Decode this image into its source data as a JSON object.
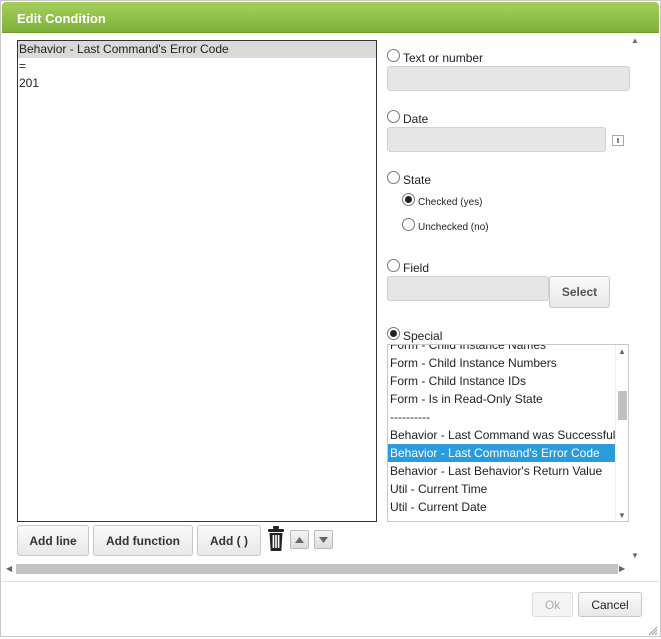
{
  "dialog": {
    "title": "Edit Condition"
  },
  "expression": {
    "lines": [
      "Behavior - Last Command's Error Code",
      "=",
      "201"
    ]
  },
  "toolbar": {
    "add_line": "Add line",
    "add_function": "Add function",
    "add_parens": "Add ( )"
  },
  "options": {
    "text_or_number": "Text or number",
    "date": "Date",
    "state": "State",
    "checked": "Checked (yes)",
    "unchecked": "Unchecked (no)",
    "field": "Field",
    "select": "Select",
    "special": "Special"
  },
  "special_list": {
    "items": [
      "Form - Child Instance Names",
      "Form - Child Instance Numbers",
      "Form - Child Instance IDs",
      "Form - Is in Read-Only State",
      "----------",
      "Behavior - Last Command was Successful",
      "Behavior - Last Command's Error Code",
      "Behavior - Last Behavior's Return Value",
      "Util - Current Time",
      "Util - Current Date"
    ],
    "selected": "Behavior - Last Command's Error Code"
  },
  "footer": {
    "ok": "Ok",
    "cancel": "Cancel"
  }
}
